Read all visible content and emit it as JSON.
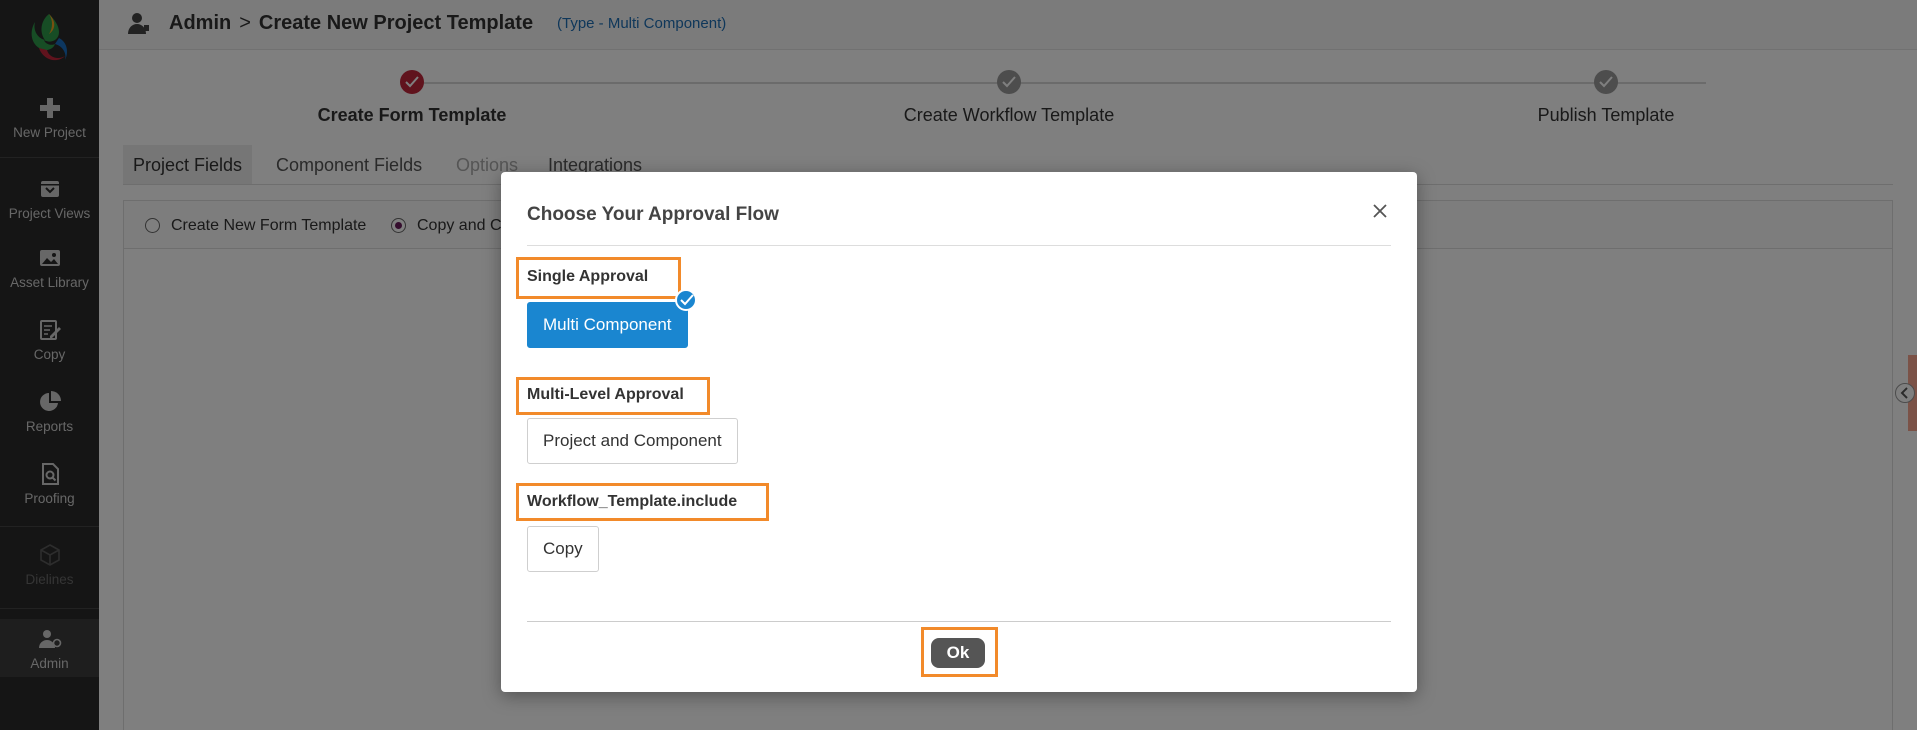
{
  "sidebar": {
    "items": [
      {
        "label": "New Project",
        "icon": "plus-icon"
      },
      {
        "label": "Project Views",
        "icon": "inbox-icon"
      },
      {
        "label": "Asset Library",
        "icon": "image-icon"
      },
      {
        "label": "Copy",
        "icon": "edit-icon"
      },
      {
        "label": "Reports",
        "icon": "pie-chart-icon"
      },
      {
        "label": "Proofing",
        "icon": "proof-search-icon"
      },
      {
        "label": "Dielines",
        "icon": "box-icon"
      },
      {
        "label": "Admin",
        "icon": "admin-user-icon"
      }
    ]
  },
  "header": {
    "breadcrumb": {
      "root": "Admin",
      "separator": ">",
      "current": "Create New Project Template"
    },
    "type_label": "(Type - Multi Component)"
  },
  "stepper": {
    "steps": [
      {
        "label": "Create Form Template",
        "done": true
      },
      {
        "label": "Create Workflow Template",
        "done": false
      },
      {
        "label": "Publish Template",
        "done": false
      }
    ]
  },
  "tabs": [
    "Project Fields",
    "Component Fields",
    "Options",
    "Integrations"
  ],
  "form_options": {
    "option1": "Create New Form Template",
    "option2": "Copy and C"
  },
  "modal": {
    "title": "Choose Your Approval Flow",
    "sections": [
      {
        "label": "Single Approval",
        "button": "Multi Component",
        "selected": true
      },
      {
        "label": "Multi-Level Approval",
        "button": "Project and Component",
        "selected": false
      },
      {
        "label": "Workflow_Template.include",
        "button": "Copy",
        "selected": false
      }
    ],
    "ok_label": "Ok"
  },
  "colors": {
    "sidebar_bg": "#2a2a2a",
    "accent_blue": "#1a86d0",
    "highlight_orange": "#f28a2a",
    "step_done": "#c0263b"
  }
}
